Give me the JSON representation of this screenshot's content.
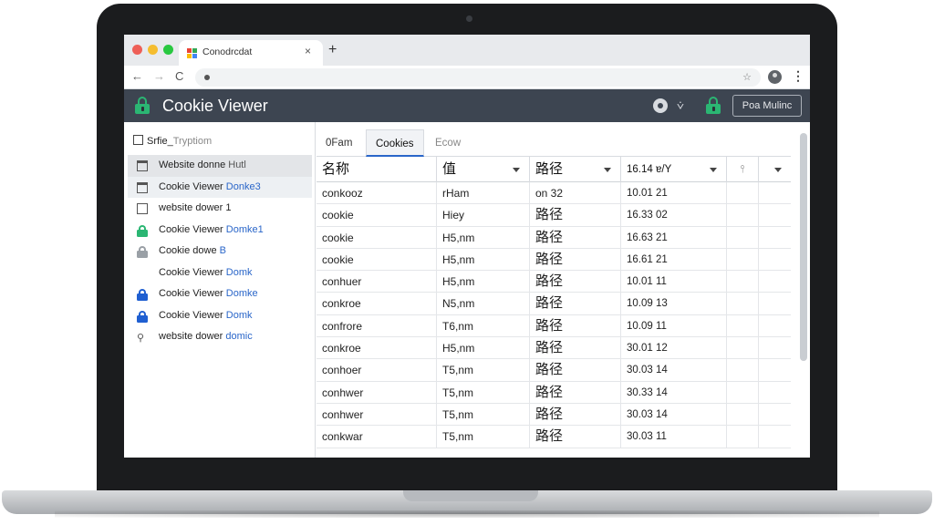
{
  "browser": {
    "tab_title": "Conodrcdat",
    "new_tab": "+",
    "close": "×",
    "back": "←",
    "forward": "→",
    "reload": "C",
    "omni_star": "☆",
    "menu": "⋮",
    "favicon_colors": [
      "#ea4335",
      "#34a853",
      "#fbbc05",
      "#4285f4"
    ]
  },
  "app": {
    "title": "Cookie Viewer",
    "header_button": "Poa Mulinc",
    "filter_symbol": "⩒",
    "accent": "#2bb673",
    "header_bg": "#3d4551"
  },
  "sidebar": {
    "header_first": "Srfie_",
    "header_rest": "Tryptiom",
    "items": [
      {
        "icon": "sheet-icon",
        "label": "Website donne",
        "suffix": "Hutl"
      },
      {
        "icon": "window-icon",
        "label": "Cookie Viewer",
        "suffix": "Donke3"
      },
      {
        "icon": "box-icon",
        "label": "website dower 1",
        "suffix": ""
      },
      {
        "icon": "lock-green-icon",
        "label": "Cookie Viewer",
        "suffix": "Domke1"
      },
      {
        "icon": "lock-gray-icon",
        "label": "Cookie dowe",
        "suffix": "B"
      },
      {
        "icon": "none",
        "label": "Cookie Viewer",
        "suffix": "Domk"
      },
      {
        "icon": "lock-blue-icon",
        "label": "Cookie Viewer",
        "suffix": "Domke"
      },
      {
        "icon": "lock-blue-icon",
        "label": "Cookie Viewer",
        "suffix": "Domk"
      },
      {
        "icon": "key-icon",
        "label": "website dower",
        "suffix": "domic"
      }
    ]
  },
  "main": {
    "tabs": [
      "0Fam",
      "Cookies",
      "Ecow"
    ],
    "columns": [
      "名称",
      "值",
      "路径",
      "16.14 ɐ/Y",
      "⫯",
      ""
    ],
    "rows": [
      [
        "conkooz",
        "rHam",
        "on 32",
        "10.01 21"
      ],
      [
        "cookie",
        "Hiey",
        "路径",
        "16.33 02"
      ],
      [
        "cookie",
        "H5,nm",
        "路径",
        "16.63 21"
      ],
      [
        "cookie",
        "H5,nm",
        "路径",
        "16.61 21"
      ],
      [
        "conhuer",
        "H5,nm",
        "路径",
        "10.01 11"
      ],
      [
        "conkroe",
        "N5,nm",
        "路径",
        "10.09 13"
      ],
      [
        "confrore",
        "T6,nm",
        "路径",
        "10.09 11"
      ],
      [
        "conkroe",
        "H5,nm",
        "路径",
        "30.01 12"
      ],
      [
        "conhoer",
        "T5,nm",
        "路径",
        "30.03 14"
      ],
      [
        "conhwer",
        "T5,nm",
        "路径",
        "30.33 14"
      ],
      [
        "conhwer",
        "T5,nm",
        "路径",
        "30.03 14"
      ],
      [
        "conkwar",
        "T5,nm",
        "路径",
        "30.03 11"
      ]
    ]
  }
}
